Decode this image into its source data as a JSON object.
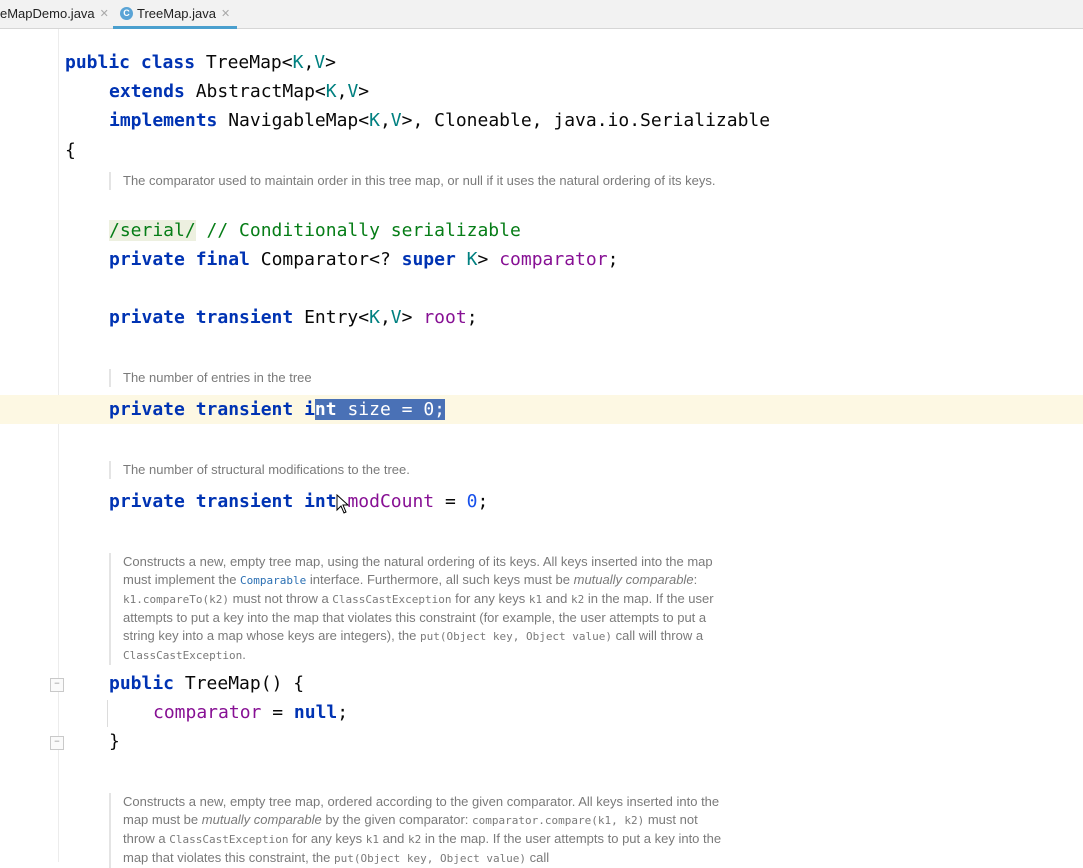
{
  "tabs": [
    {
      "label": "eMapDemo.java"
    },
    {
      "label": "TreeMap.java",
      "icon": "C"
    }
  ],
  "code": {
    "l1": {
      "kw": "public class",
      "name": "TreeMap",
      "open": "<",
      "k": "K",
      "comma": ",",
      "v": "V",
      "close": ">"
    },
    "l2": {
      "kw": "extends",
      "name": "AbstractMap",
      "open": "<",
      "k": "K",
      "comma": ",",
      "v": "V",
      "close": ">"
    },
    "l3": {
      "kw": "implements",
      "name": "NavigableMap",
      "open": "<",
      "k": "K",
      "comma": ",",
      "v": "V",
      "rest": ">, Cloneable, java.io.Serializable"
    },
    "l4": "{",
    "l5": {
      "tag": "/serial/",
      "comment": " // Conditionally serializable"
    },
    "l6": {
      "kw": "private final",
      "type": "Comparator<? ",
      "kw2": "super",
      "k": "K",
      "close": "> ",
      "field": "comparator",
      "end": ";"
    },
    "l7": {
      "kw": "private transient",
      "type": "Entry<",
      "k": "K",
      "comma": ",",
      "v": "V",
      "close": "> ",
      "field": "root",
      "end": ";"
    },
    "l8": {
      "kw": "private transient",
      "pre": "i",
      "selkw": "nt",
      "selrest": " size = ",
      "selnum": "0",
      "selend": ";"
    },
    "l9": {
      "kw": "private transient",
      "kw2": "int",
      "field": "modCount",
      "mid": " = ",
      "num": "0",
      "end": ";"
    },
    "l10": {
      "kw": "public",
      "rest": "TreeMap() {"
    },
    "l11": {
      "field": "comparator",
      "mid": " = ",
      "kw": "null",
      "end": ";"
    },
    "l12": "}"
  },
  "docs": {
    "d1": "The comparator used to maintain order in this tree map, or null if it uses the natural ordering of its keys.",
    "d2": "The number of entries in the tree",
    "d3": "The number of structural modifications to the tree.",
    "d4": {
      "a": "Constructs a new, empty tree map, using the natural ordering of its keys. All keys inserted into the map must implement the ",
      "b": "Comparable",
      "c": " interface. Furthermore, all such keys must be ",
      "d": "mutually comparable",
      "e": ": ",
      "f": "k1.compareTo(k2)",
      "g": " must not throw a ",
      "h": "ClassCastException",
      "i": " for any keys ",
      "j": "k1",
      "k": " and ",
      "l": "k2",
      "m": " in the map. If the user attempts to put a key into the map that violates this constraint (for example, the user attempts to put a string key into a map whose keys are integers), the ",
      "n": "put(Object key, Object value)",
      "o": " call will throw a ",
      "p": "ClassCastException",
      "q": "."
    },
    "d5": {
      "a": "Constructs a new, empty tree map, ordered according to the given comparator. All keys inserted into the map must be ",
      "b": "mutually comparable",
      "c": " by the given comparator: ",
      "d": "comparator.compare(k1, k2)",
      "e": " must not throw a ",
      "f": "ClassCastException",
      "g": " for any keys ",
      "h": "k1",
      "i": " and ",
      "j": "k2",
      "k": " in the map. If the user attempts to put a key into the map that violates this constraint, the ",
      "l": "put(Object key, Object value)",
      "m": " call"
    }
  }
}
